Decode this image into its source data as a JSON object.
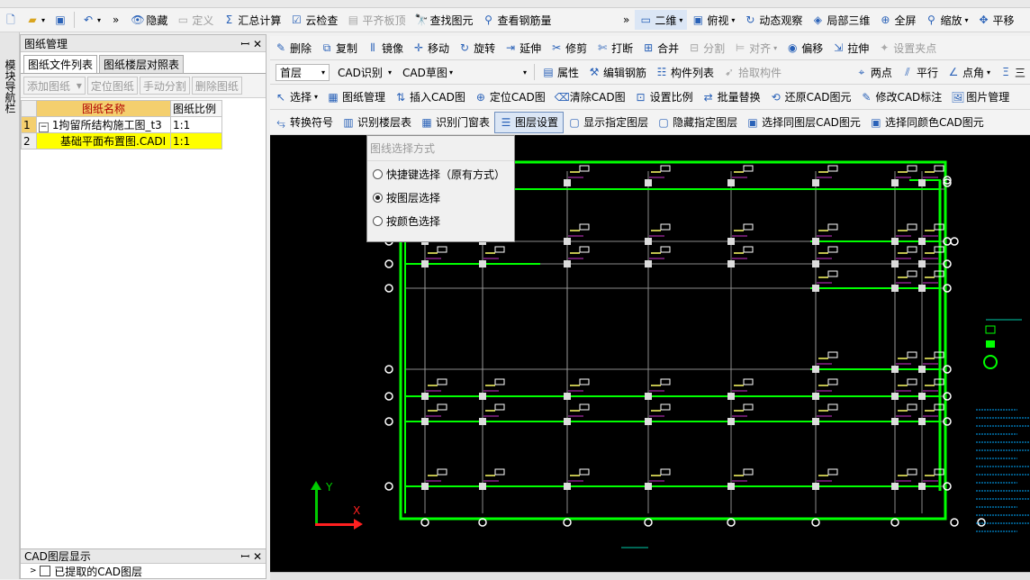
{
  "toolbar1": [
    {
      "label": "隐藏",
      "icon": "eye-icon",
      "dim": false
    },
    {
      "label": "定义",
      "icon": "define-icon",
      "dim": true
    },
    {
      "label": "汇总计算",
      "icon": "sigma-icon",
      "dim": false
    },
    {
      "label": "云检查",
      "icon": "cloud-check-icon",
      "dim": false
    },
    {
      "label": "平齐板顶",
      "icon": "align-slab-top-icon",
      "dim": true
    },
    {
      "label": "查找图元",
      "icon": "find-element-icon",
      "dim": false
    },
    {
      "label": "查看钢筋量",
      "icon": "rebar-quantity-icon",
      "dim": false
    }
  ],
  "toolbar1_right": [
    {
      "label": "二维",
      "icon": "2d-icon",
      "dropdown": true
    },
    {
      "label": "俯视",
      "icon": "top-view-icon",
      "dropdown": true
    },
    {
      "label": "动态观察",
      "icon": "orbit-icon",
      "dropdown": false
    },
    {
      "label": "局部三维",
      "icon": "local-3d-icon",
      "dropdown": false
    },
    {
      "label": "全屏",
      "icon": "fullscreen-icon",
      "dropdown": false
    },
    {
      "label": "缩放",
      "icon": "zoom-icon",
      "dropdown": true
    },
    {
      "label": "平移",
      "icon": "pan-icon",
      "dropdown": false
    }
  ],
  "left_rail_text": "模块导航栏",
  "drawing_panel": {
    "title": "图纸管理",
    "tabs": [
      "图纸文件列表",
      "图纸楼层对照表"
    ],
    "buttons": [
      "添加图纸",
      "定位图纸",
      "手动分割",
      "删除图纸"
    ],
    "columns": [
      "图纸名称",
      "图纸比例"
    ],
    "rows": [
      {
        "num": "1",
        "name": "1拘留所结构施工图_t3",
        "scale": "1:1"
      },
      {
        "num": "2",
        "name": "基础平面布置图.CADI",
        "scale": "1:1"
      }
    ]
  },
  "layer_panel": {
    "title": "CAD图层显示",
    "item": "已提取的CAD图层"
  },
  "edit_toolbar": [
    "删除",
    "复制",
    "镜像",
    "移动",
    "旋转",
    "延伸",
    "修剪",
    "打断",
    "合并",
    "分割",
    "对齐",
    "偏移",
    "拉伸",
    "设置夹点"
  ],
  "selector_toolbar": {
    "floor": "首层",
    "cad_recog": "CAD识别",
    "cad_sketch": "CAD草图",
    "empty_combo": "",
    "buttons": [
      "属性",
      "编辑钢筋",
      "构件列表",
      "拾取构件"
    ],
    "right_buttons": [
      "两点",
      "平行",
      "点角",
      "三"
    ]
  },
  "cad_toolbar": [
    "选择",
    "图纸管理",
    "插入CAD图",
    "定位CAD图",
    "清除CAD图",
    "设置比例",
    "批量替换",
    "还原CAD图元",
    "修改CAD标注",
    "图片管理"
  ],
  "layer_toolbar": [
    "转换符号",
    "识别楼层表",
    "识别门窗表",
    "图层设置",
    "显示指定图层",
    "隐藏指定图层",
    "选择同图层CAD图元",
    "选择同颜色CAD图元"
  ],
  "selection_popup": {
    "title": "图线选择方式",
    "options": [
      {
        "label": "快捷键选择（原有方式）",
        "selected": false
      },
      {
        "label": "按图层选择",
        "selected": true
      },
      {
        "label": "按颜色选择",
        "selected": false
      }
    ]
  },
  "axis": {
    "x": "X",
    "y": "Y"
  },
  "colors": {
    "canvas_bg": "#000000",
    "green": "#00ff00",
    "axis_y": "#00cc00",
    "axis_x": "#ff2020",
    "highlight_row": "#ffff00",
    "header_cell": "#f4cf6e"
  }
}
